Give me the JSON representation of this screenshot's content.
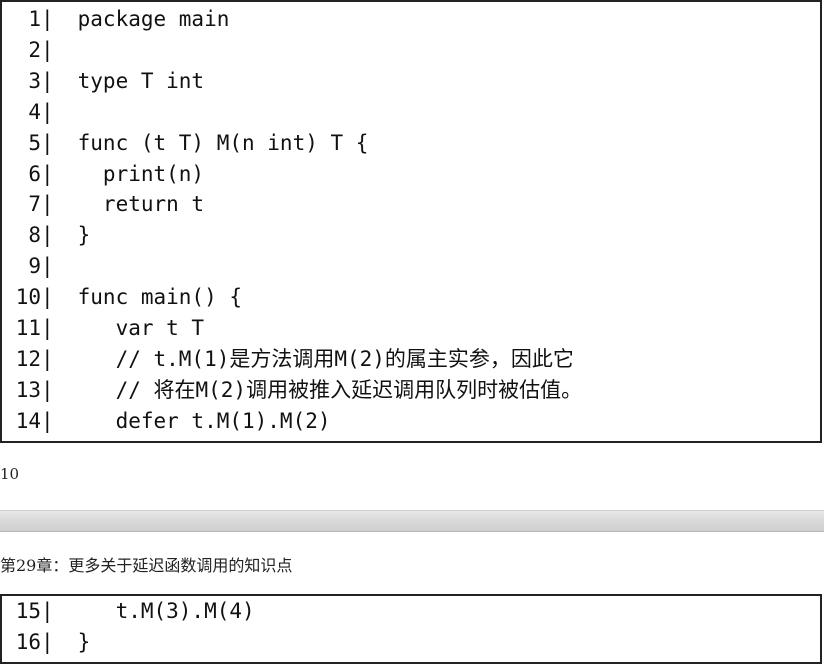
{
  "code_top": [
    {
      "num": "1",
      "sep": "|",
      "text": " package main"
    },
    {
      "num": "2",
      "sep": "|",
      "text": ""
    },
    {
      "num": "3",
      "sep": "|",
      "text": " type T int"
    },
    {
      "num": "4",
      "sep": "|",
      "text": ""
    },
    {
      "num": "5",
      "sep": "|",
      "text": " func (t T) M(n int) T {"
    },
    {
      "num": "6",
      "sep": "|",
      "text": "   print(n)"
    },
    {
      "num": "7",
      "sep": "|",
      "text": "   return t"
    },
    {
      "num": "8",
      "sep": "|",
      "text": " }"
    },
    {
      "num": "9",
      "sep": "|",
      "text": ""
    },
    {
      "num": "10",
      "sep": "|",
      "text": " func main() {"
    },
    {
      "num": "11",
      "sep": "|",
      "text": "    var t T"
    },
    {
      "num": "12",
      "sep": "|",
      "text": "    // t.M(1)是方法调用M(2)的属主实参，因此它"
    },
    {
      "num": "13",
      "sep": "|",
      "text": "    // 将在M(2)调用被推入延迟调用队列时被估值。"
    },
    {
      "num": "14",
      "sep": "|",
      "text": "    defer t.M(1).M(2)"
    }
  ],
  "page_number": "10",
  "chapter_header": "第29章：更多关于延迟函数调用的知识点",
  "code_bottom": [
    {
      "num": "15",
      "sep": "|",
      "text": "    t.M(3).M(4)"
    },
    {
      "num": "16",
      "sep": "|",
      "text": " }"
    }
  ]
}
